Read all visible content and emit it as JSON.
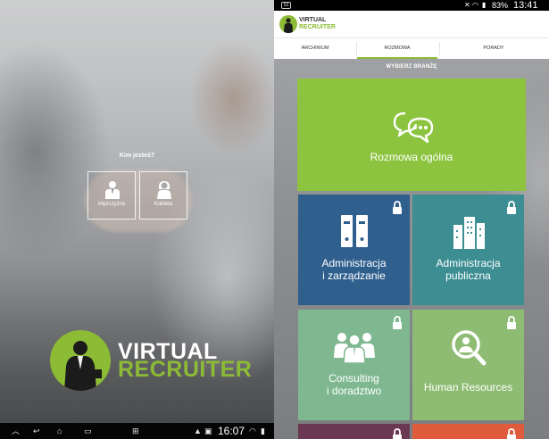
{
  "colors": {
    "brand_green": "#8cbb35",
    "tile_general": "#8cc43f",
    "tile_admin": "#2f5f8d",
    "tile_public": "#3c8e92",
    "tile_consulting": "#7fb890",
    "tile_hr": "#8ebc73",
    "tile_bottom_left": "#6b3854",
    "tile_bottom_right": "#e05a3c"
  },
  "login": {
    "question": "Kim jesteś?",
    "options": [
      {
        "label": "Mężczyzna",
        "icon": "man-icon"
      },
      {
        "label": "Kobieta",
        "icon": "woman-icon"
      }
    ],
    "logo": {
      "line1": "VIRTUAL",
      "line2": "RECRUITER"
    }
  },
  "left_navbar": {
    "time": "16:07",
    "icons": [
      "chevron-up-icon",
      "back-icon",
      "home-icon",
      "recent-apps-icon",
      "screenshot-icon",
      "menu-up-icon",
      "gallery-icon",
      "download-icon",
      "wifi-icon",
      "signal-icon"
    ]
  },
  "status_bar": {
    "notification": "63",
    "battery": "83%",
    "time": "13:41"
  },
  "app_header": {
    "logo_line1": "VIRTUAL",
    "logo_line2": "RECRUITER"
  },
  "tabs": [
    {
      "label": "ARCHIWUM",
      "active": false
    },
    {
      "label": "ROZMOWA",
      "active": true
    },
    {
      "label": "PORADY",
      "active": false
    }
  ],
  "industry_prompt": "WYBIERZ BRANŻĘ",
  "tiles": {
    "general": {
      "label": "Rozmowa ogólna",
      "icon": "chat-icon"
    },
    "admin": {
      "line1": "Administracja",
      "line2": "i zarządzanie",
      "icon": "binders-icon",
      "locked": true
    },
    "public": {
      "line1": "Administracja",
      "line2": "publiczna",
      "icon": "buildings-icon",
      "locked": true
    },
    "consulting": {
      "line1": "Consulting",
      "line2": "i doradztwo",
      "icon": "group-icon",
      "locked": true
    },
    "hr": {
      "label": "Human Resources",
      "icon": "magnifier-person-icon",
      "locked": true
    }
  }
}
